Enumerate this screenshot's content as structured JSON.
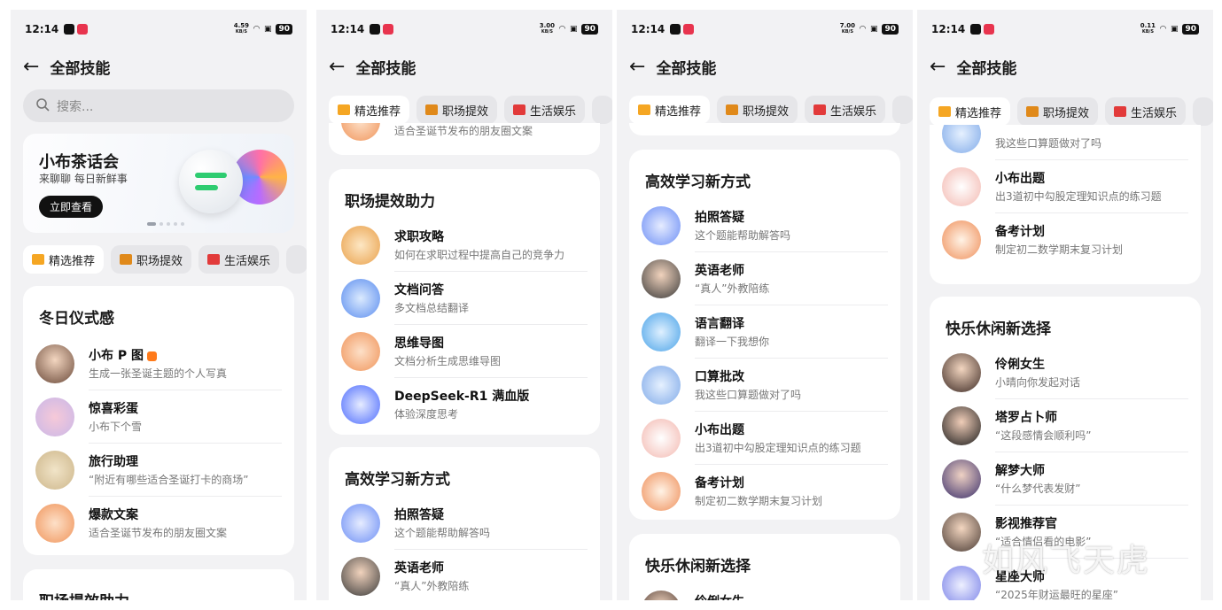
{
  "status": {
    "time": "12:14",
    "battery": "90",
    "speeds": [
      "4.59",
      "3.00",
      "7.00",
      "0.11"
    ],
    "unit": "KB/S"
  },
  "header": {
    "title": "全部技能"
  },
  "search": {
    "placeholder": "搜索..."
  },
  "banner": {
    "title": "小布茶话会",
    "subtitle": "来聊聊 每日新鲜事",
    "button": "立即查看"
  },
  "tabs": [
    "精选推荐",
    "职场提效",
    "生活娱乐"
  ],
  "sections": {
    "winter": {
      "title": "冬日仪式感",
      "items": [
        {
          "name": "小布 P 图",
          "desc": "生成一张圣诞主题的个人写真"
        },
        {
          "name": "惊喜彩蛋",
          "desc": "小布下个雪"
        },
        {
          "name": "旅行助理",
          "desc": "“附近有哪些适合圣诞打卡的商场”"
        },
        {
          "name": "爆款文案",
          "desc": "适合圣诞节发布的朋友圈文案"
        }
      ]
    },
    "work": {
      "title": "职场提效助力",
      "items": [
        {
          "name": "求职攻略",
          "desc": "如何在求职过程中提高自己的竞争力"
        },
        {
          "name": "文档问答",
          "desc": "多文档总结翻译"
        },
        {
          "name": "思维导图",
          "desc": "文档分析生成思维导图"
        },
        {
          "name": "DeepSeek-R1 满血版",
          "desc": "体验深度思考"
        }
      ]
    },
    "study": {
      "title": "高效学习新方式",
      "items": [
        {
          "name": "拍照答疑",
          "desc": "这个题能帮助解答吗"
        },
        {
          "name": "英语老师",
          "desc": "“真人”外教陪练"
        },
        {
          "name": "语言翻译",
          "desc": "翻译一下我想你"
        },
        {
          "name": "口算批改",
          "desc": "我这些口算题做对了吗"
        },
        {
          "name": "小布出题",
          "desc": "出3道初中勾股定理知识点的练习题"
        },
        {
          "name": "备考计划",
          "desc": "制定初二数学期末复习计划"
        }
      ]
    },
    "fun": {
      "title": "快乐休闲新选择",
      "items": [
        {
          "name": "伶俐女生",
          "desc": "小晴向你发起对话"
        },
        {
          "name": "塔罗占卜师",
          "desc": "“这段感情会顺利吗”"
        },
        {
          "name": "解梦大师",
          "desc": "“什么梦代表发财”"
        },
        {
          "name": "影视推荐官",
          "desc": "“适合情侣看的电影”"
        },
        {
          "name": "星座大师",
          "desc": "“2025年财运最旺的星座”"
        }
      ]
    },
    "partial": {
      "desc1": "适合圣诞节发布的朋友圈文案"
    }
  },
  "watermark": "如风飞天虎",
  "colors": {
    "accent": "#2ecc71",
    "tab_like": "#f5a623",
    "tab_work": "#e0891a",
    "tab_life": "#e23a3a"
  }
}
